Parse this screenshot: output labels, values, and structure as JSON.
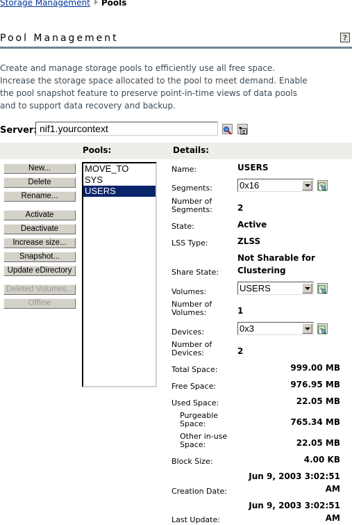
{
  "breadcrumb": {
    "parent": "Storage Management",
    "current": "Pools"
  },
  "page": {
    "title": "Pool Management",
    "help_icon": "help-icon",
    "description": "Create and manage storage pools to efficiently use all free space. Increase the storage space allocated to the pool to meet demand. Enable the pool snapshot feature to preserve point-in-time views of data pools and to support data recovery and backup."
  },
  "server": {
    "label": "Server:",
    "value": "nif1.yourcontext",
    "search_icon": "search-icon",
    "browse_icon": "browse-tree-icon"
  },
  "headers": {
    "pools": "Pools:",
    "details": "Details:"
  },
  "buttons": [
    {
      "label": "New...",
      "enabled": true
    },
    {
      "label": "Delete",
      "enabled": true
    },
    {
      "label": "Rename...",
      "enabled": true
    },
    {
      "label": "Activate",
      "enabled": true
    },
    {
      "label": "Deactivate",
      "enabled": true
    },
    {
      "label": "Increase size...",
      "enabled": true
    },
    {
      "label": "Snapshot...",
      "enabled": true
    },
    {
      "label": "Update eDirectory",
      "enabled": true
    },
    {
      "label": "Deleted Volumes...",
      "enabled": false
    },
    {
      "label": "Offline",
      "enabled": false
    }
  ],
  "pools": {
    "items": [
      "MOVE_TO",
      "SYS",
      "USERS"
    ],
    "selected": "USERS"
  },
  "details": {
    "name": {
      "label": "Name:",
      "value": "USERS"
    },
    "segments": {
      "label": "Segments:",
      "value": "0x16"
    },
    "num_segments": {
      "label": "Number of Segments:",
      "label1": "Number of",
      "label2": "Segments:",
      "value": "2"
    },
    "state": {
      "label": "State:",
      "value": "Active"
    },
    "lss_type": {
      "label": "LSS Type:",
      "value": "ZLSS"
    },
    "share_state": {
      "label": "Share State:",
      "value1": "Not Sharable for",
      "value2": "Clustering"
    },
    "volumes": {
      "label": "Volumes:",
      "value": "USERS"
    },
    "num_volumes": {
      "label1": "Number of",
      "label2": "Volumes:",
      "value": "1"
    },
    "devices": {
      "label": "Devices:",
      "value": "0x3"
    },
    "num_devices": {
      "label1": "Number of",
      "label2": "Devices:",
      "value": "2"
    },
    "total_space": {
      "label": "Total Space:",
      "value": "999.00 MB"
    },
    "free_space": {
      "label": "Free Space:",
      "value": "976.95 MB"
    },
    "used_space": {
      "label": "Used Space:",
      "value": "22.05 MB"
    },
    "purgeable_space": {
      "label1": "Purgeable",
      "label2": "Space:",
      "value": "765.34 MB"
    },
    "other_inuse_space": {
      "label1": "Other in-use",
      "label2": "Space:",
      "value": "22.05 MB"
    },
    "block_size": {
      "label": "Block Size:",
      "value": "4.00 KB"
    },
    "creation_date": {
      "label": "Creation Date:",
      "value1": "Jun 9, 2003 3:02:51",
      "value2": "AM"
    },
    "last_update": {
      "label": "Last Update:",
      "value1": "Jun 9, 2003 3:02:51",
      "value2": "AM"
    }
  }
}
